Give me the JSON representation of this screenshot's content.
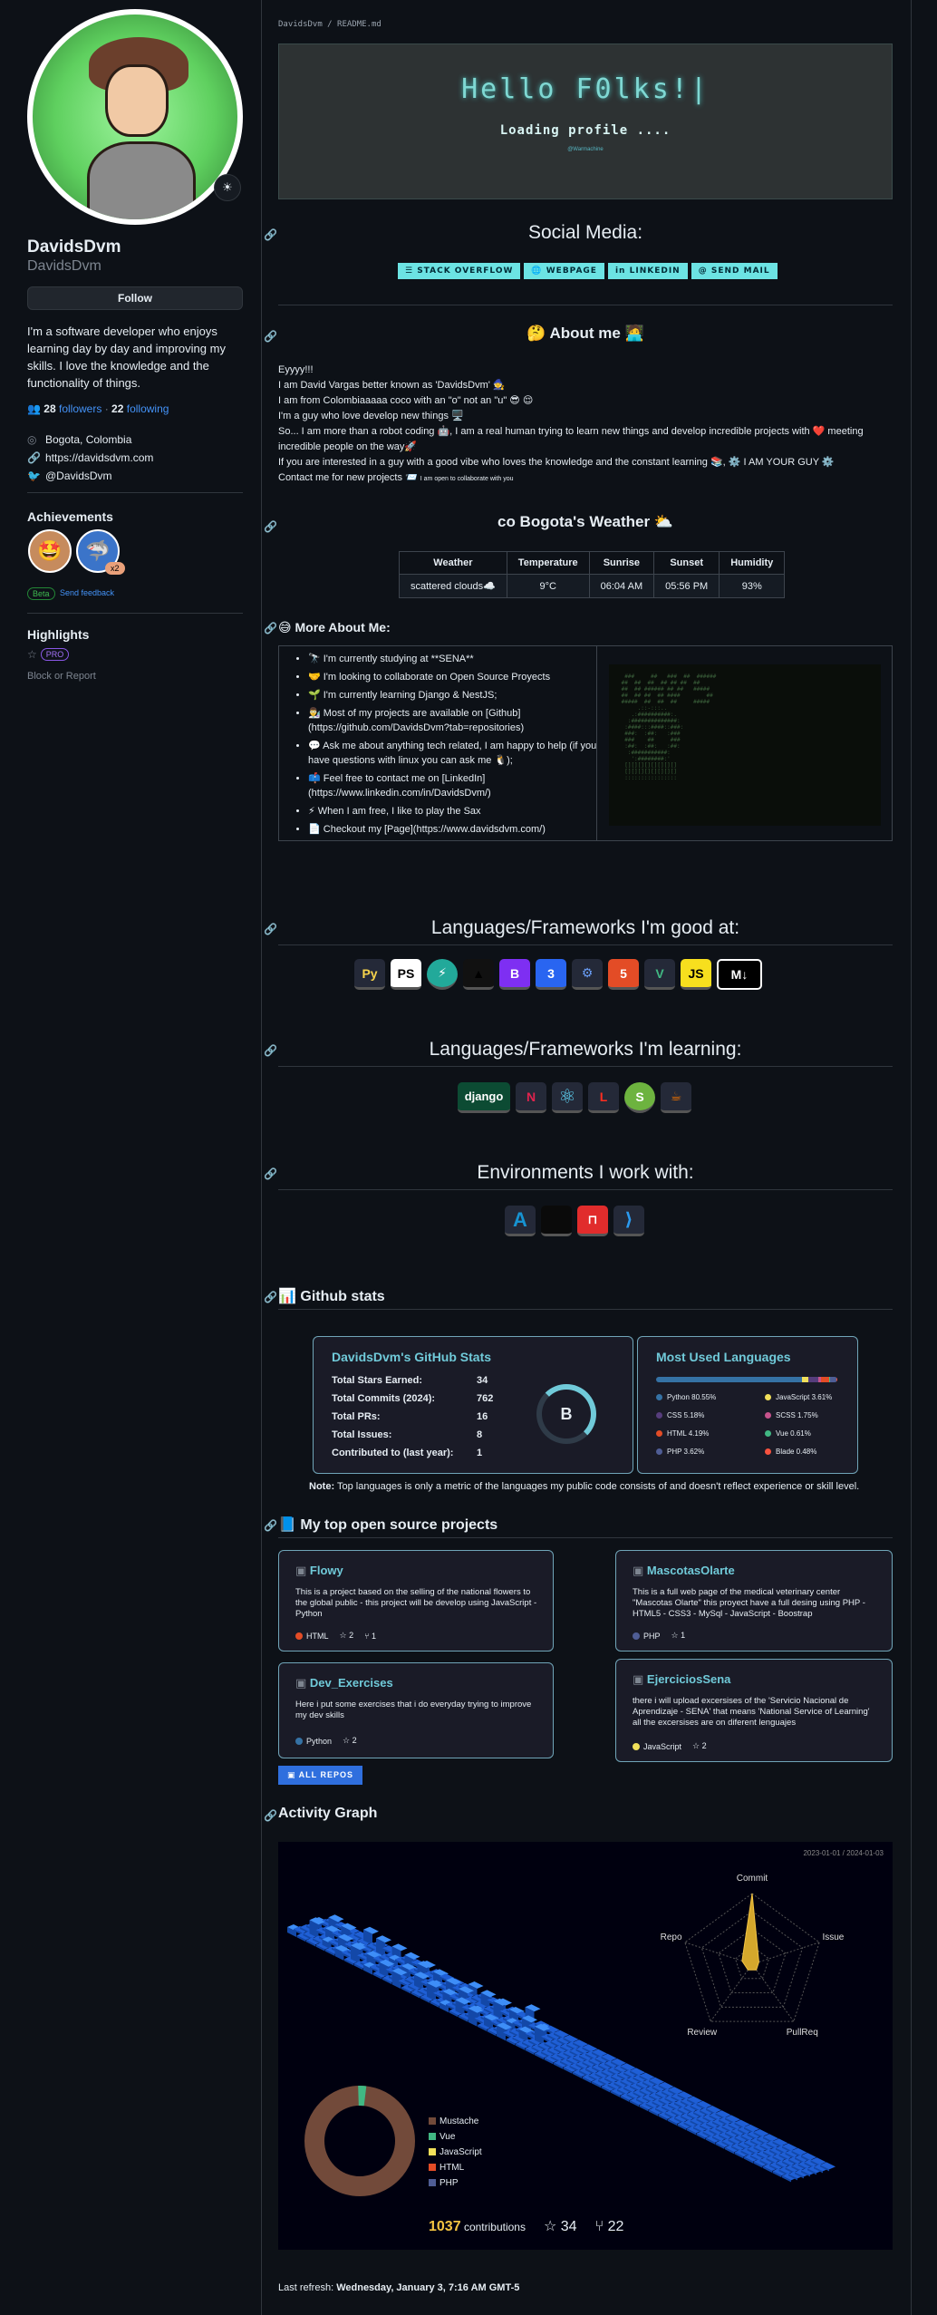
{
  "profile": {
    "name": "DavidsDvm",
    "login": "DavidsDvm",
    "follow_label": "Follow",
    "bio": "I'm a software developer who enjoys learning day by day and improving my skills. I love the knowledge and the functionality of things.",
    "followers": "28",
    "followers_label": "followers",
    "following": "22",
    "following_label": "following",
    "location": "Bogota, Colombia",
    "website": "https://davidsdvm.com",
    "twitter": "@DavidsDvm",
    "achievements_title": "Achievements",
    "achievement_count": "x2",
    "beta_label": "Beta",
    "feedback_label": "Send feedback",
    "highlights_title": "Highlights",
    "pro_label": "PRO",
    "block_label": "Block or Report"
  },
  "readme": {
    "path": "DavidsDvm / README.md",
    "hello": "Hello F0lks!|",
    "loading": "Loading profile ....",
    "credit": "@Warmachine"
  },
  "social": {
    "title": "Social Media:",
    "buttons": [
      "STACK OVERFLOW",
      "WEBPAGE",
      "LINKEDIN",
      "SEND MAIL"
    ]
  },
  "about": {
    "title": "🤔 About me 🧑‍💻",
    "lines": [
      "Eyyyy!!!",
      "I am David Vargas better known as 'DavidsDvm' 🧙",
      "I am from Colombiaaaaa coco with an \"o\" not an \"u\" 😎 😌",
      "I'm a guy who love develop new things 🖥️",
      "So... I am more than a robot coding 🤖, I am a real human trying to learn new things and develop incredible projects with ❤️ meeting incredible people on the way🚀",
      "If you are interested in a guy with a good vibe who loves the knowledge and the constant learning 📚, ⚙️ I AM YOUR GUY ⚙️",
      "Contact me for new projects 📨"
    ],
    "small": "I am open to collaborate with you"
  },
  "weather": {
    "title": "co Bogota's Weather ⛅",
    "headers": [
      "Weather",
      "Temperature",
      "Sunrise",
      "Sunset",
      "Humidity"
    ],
    "row": [
      "scattered clouds☁️",
      "9°C",
      "06:04 AM",
      "05:56 PM",
      "93%"
    ]
  },
  "more": {
    "title": "😅 More About Me:",
    "items": [
      "🔭 I'm currently studying at **SENA**",
      "🤝 I'm looking to collaborate on Open Source Proyects",
      "🌱 I'm currently learning Django & NestJS;",
      "👨‍🔬 Most of my projects are available on [Github](https://github.com/DavidsDvm?tab=repositories)",
      "💬 Ask me about anything tech related, I am happy to help (if you have questions with linux you can ask me 🐧);",
      "📫 Feel free to contact me on [LinkedIn](https://www.linkedin.com/in/DavidsDvm/)",
      "⚡ When I am free, I like to play the Sax",
      "📄 Checkout my [Page](https://www.davidsdvm.com/)"
    ]
  },
  "good_at": {
    "title": "Languages/Frameworks I'm good at:",
    "icons": [
      "Py",
      "PS",
      "⚡",
      "▲",
      "B",
      "3",
      "⚙",
      "5",
      "V",
      "JS",
      "M↓"
    ]
  },
  "learning": {
    "title": "Languages/Frameworks I'm learning:",
    "icons": [
      "django",
      "N",
      "⚛",
      "L",
      "S",
      "☕"
    ]
  },
  "env": {
    "title": "Environments I work with:",
    "icons": [
      "A",
      "",
      "⊓",
      "⟩"
    ]
  },
  "stats": {
    "section_title": "📊 Github stats",
    "title": "DavidsDvm's GitHub Stats",
    "rows": [
      [
        "Total Stars Earned:",
        "34"
      ],
      [
        "Total Commits (2024):",
        "762"
      ],
      [
        "Total PRs:",
        "16"
      ],
      [
        "Total Issues:",
        "8"
      ],
      [
        "Contributed to (last year):",
        "1"
      ]
    ],
    "grade": "B",
    "langs_title": "Most Used Languages",
    "langs": [
      {
        "name": "Python 80.55%",
        "color": "#3572A5",
        "pct": 80.55
      },
      {
        "name": "JavaScript 3.61%",
        "color": "#f1e05a",
        "pct": 3.61
      },
      {
        "name": "CSS 5.18%",
        "color": "#563d7c",
        "pct": 5.18
      },
      {
        "name": "SCSS 1.75%",
        "color": "#c6538c",
        "pct": 1.75
      },
      {
        "name": "HTML 4.19%",
        "color": "#e34c26",
        "pct": 4.19
      },
      {
        "name": "Vue 0.61%",
        "color": "#41b883",
        "pct": 0.61
      },
      {
        "name": "PHP 3.62%",
        "color": "#4F5D95",
        "pct": 3.62
      },
      {
        "name": "Blade 0.48%",
        "color": "#f7523f",
        "pct": 0.48
      }
    ],
    "note_bold": "Note:",
    "note": "Top languages is only a metric of the languages my public code consists of and doesn't reflect experience or skill level."
  },
  "projects": {
    "title": "📘 My top open source projects",
    "repos": [
      {
        "name": "Flowy",
        "desc": "This is a project based on the selling of the national flowers to the global public - this project will be develop using JavaScript - Python",
        "lang": "HTML",
        "color": "#e34c26",
        "stars": "2",
        "forks": "1"
      },
      {
        "name": "MascotasOlarte",
        "desc": "This is a full web page of the medical veterinary center \"Mascotas Olarte\" this proyect have a full desing using PHP - HTML5 - CSS3 - MySql - JavaScript - Boostrap",
        "lang": "PHP",
        "color": "#4F5D95",
        "stars": "1",
        "forks": ""
      },
      {
        "name": "Dev_Exercises",
        "desc": "Here i put some exercises that i do everyday trying to improve my dev skills",
        "lang": "Python",
        "color": "#3572A5",
        "stars": "2",
        "forks": ""
      },
      {
        "name": "EjerciciosSena",
        "desc": "there i will upload excersises of the 'Servicio Nacional de Aprendizaje - SENA' that means 'National Service of Learning' all the excersises are on diferent lenguajes",
        "lang": "JavaScript",
        "color": "#f1e05a",
        "stars": "2",
        "forks": ""
      }
    ],
    "all_label": "ALL REPOS"
  },
  "activity": {
    "title": "Activity Graph",
    "range": "2023-01-01 / 2024-01-03",
    "radar_labels": [
      "Commit",
      "Issue",
      "PullReq",
      "Review",
      "Repo"
    ],
    "radar_values": [
      1.0,
      0.1,
      0.1,
      0.1,
      0.15
    ],
    "legend": [
      {
        "name": "Mustache",
        "color": "#724a3a"
      },
      {
        "name": "Vue",
        "color": "#41b883"
      },
      {
        "name": "JavaScript",
        "color": "#f1e05a"
      },
      {
        "name": "HTML",
        "color": "#e34c26"
      },
      {
        "name": "PHP",
        "color": "#4F5D95"
      }
    ],
    "contrib_count": "1037",
    "contrib_label": "contributions",
    "stars": "34",
    "forks": "22"
  },
  "footer": {
    "prefix": "Last refresh:",
    "date": "Wednesday, January 3, 7:16 AM GMT-5"
  }
}
